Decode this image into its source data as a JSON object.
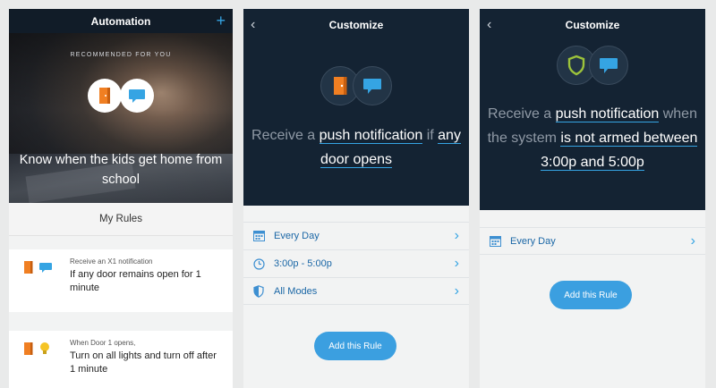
{
  "colors": {
    "nav_dark": "#111c28",
    "panel_dark": "#142333",
    "accent_blue": "#35a4e3",
    "button_blue": "#3b9fe0",
    "link_blue": "#1b67a6",
    "door_orange": "#f07f22",
    "shield_green": "#9cc33b",
    "bulb_yellow": "#f5c425"
  },
  "automation": {
    "title": "Automation",
    "add_icon": "plus-icon",
    "add_symbol": "+",
    "hero": {
      "kicker": "RECOMMENDED FOR YOU",
      "icons": [
        "door-icon",
        "chat-icon"
      ],
      "text": "Know when the kids get home from school",
      "page_count": 5,
      "active_page": 4
    },
    "my_rules_label": "My Rules",
    "rules": [
      {
        "icons": [
          "door-icon",
          "chat-icon"
        ],
        "sub": "Receive an X1 notification",
        "main": "If any door remains open for 1 minute"
      },
      {
        "icons": [
          "door-icon",
          "bulb-icon"
        ],
        "sub": "When Door 1 opens,",
        "main": "Turn on all lights and turn off after 1 minute"
      }
    ]
  },
  "customize_a": {
    "title": "Customize",
    "back_symbol": "‹",
    "icons": [
      "door-icon",
      "chat-icon"
    ],
    "sentence": {
      "pre": "Receive a ",
      "hl1": "push notification",
      "mid": " if ",
      "hl2": "any door opens"
    },
    "settings": [
      {
        "icon": "calendar-icon",
        "label": "Every Day"
      },
      {
        "icon": "clock-icon",
        "label": "3:00p - 5:00p"
      },
      {
        "icon": "shield-icon",
        "label": "All Modes"
      }
    ],
    "chevron_symbol": "›",
    "add_button": "Add this Rule"
  },
  "customize_b": {
    "title": "Customize",
    "back_symbol": "‹",
    "icons": [
      "shield-icon",
      "chat-icon"
    ],
    "sentence": {
      "pre": "Receive a ",
      "hl1": "push notification",
      "mid": " when the system ",
      "hl2": "is not armed between 3:00p and 5:00p"
    },
    "settings": [
      {
        "icon": "calendar-icon",
        "label": "Every Day"
      }
    ],
    "chevron_symbol": "›",
    "add_button": "Add this Rule"
  }
}
